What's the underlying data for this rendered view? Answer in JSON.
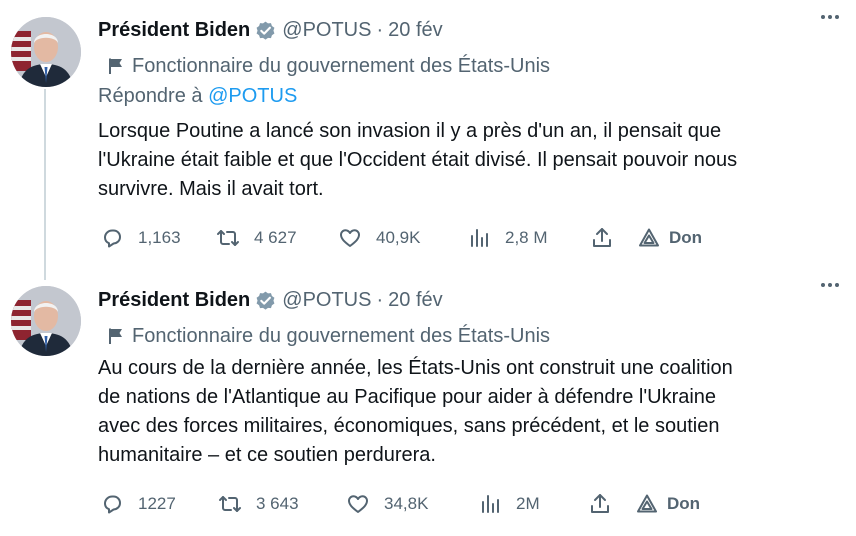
{
  "tweets": [
    {
      "author_name": "Président Biden",
      "handle": "@POTUS",
      "separator": "·",
      "date": "20 fév",
      "affiliation": "Fonctionnaire du gouvernement des États-Unis",
      "reply_prefix": "Répondre à ",
      "reply_handle": "@POTUS",
      "text": "Lorsque Poutine a lancé son invasion il y a près d'un an, il pensait que\nl'Ukraine était faible et que l'Occident était divisé.  Il pensait pouvoir nous\nsurvivre. Mais il avait tort.",
      "replies": "1,163",
      "retweets": "4 627",
      "likes": "40,9K",
      "views": "2,8 M",
      "donate_label": "Don"
    },
    {
      "author_name": "Président Biden",
      "handle": "@POTUS",
      "separator": "·",
      "date": "20 fév",
      "affiliation": "Fonctionnaire du gouvernement des États-Unis",
      "text": "Au cours de la dernière année, les États-Unis ont construit une coalition\nde nations de l'Atlantique au Pacifique pour aider à défendre l'Ukraine\navec des forces militaires, économiques, sans précédent, et le soutien\nhumanitaire – et ce soutien perdurera.",
      "replies": "1227",
      "retweets": "3 643",
      "likes": "34,8K",
      "views": "2M",
      "donate_label": "Don"
    }
  ],
  "colors": {
    "text": "#0f1419",
    "secondary": "#536471",
    "link": "#1d9bf0",
    "verified_badge": "#829aab",
    "thread_line": "#cfd9de"
  },
  "icons": {
    "avatar": "avatar-photo",
    "verified": "verified-badge-icon",
    "affiliation": "flag-icon",
    "more": "more-options-icon",
    "reply": "reply-icon",
    "retweet": "retweet-icon",
    "like": "heart-icon",
    "views": "views-icon",
    "share": "share-icon",
    "donate": "donate-icon"
  }
}
